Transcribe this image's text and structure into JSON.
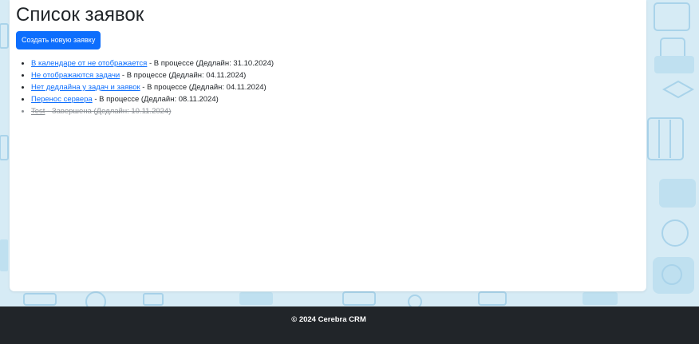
{
  "header": {
    "title": "Список заявок"
  },
  "toolbar": {
    "create_label": "Создать новую заявку"
  },
  "requests": [
    {
      "title": "В календаре от не отображается",
      "details": " - В процессе (Дедлайн: 31.10.2024)",
      "status": "in-progress"
    },
    {
      "title": "Не отображаются задачи",
      "details": " - В процессе (Дедлайн: 04.11.2024)",
      "status": "in-progress"
    },
    {
      "title": "Нет дедлайна у задач и заявок",
      "details": " - В процессе (Дедлайн: 04.11.2024)",
      "status": "in-progress"
    },
    {
      "title": "Перенос сервера",
      "details": " - В процессе (Дедлайн: 08.11.2024)",
      "status": "in-progress"
    },
    {
      "title": "Test",
      "details": " - Завершена (Дедлайн: 10.11.2024)",
      "status": "done"
    }
  ],
  "footer": {
    "copyright": "© 2024 Cerebra CRM"
  },
  "colors": {
    "accent": "#0d6efd",
    "background": "#d6ebf5",
    "footer": "#212529",
    "done_text": "#8a8f94"
  }
}
